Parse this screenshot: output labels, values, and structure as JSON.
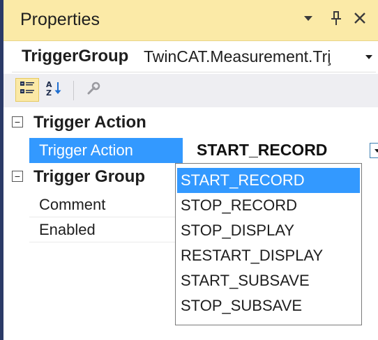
{
  "window": {
    "title": "Properties"
  },
  "object_selector": {
    "name": "TriggerGroup",
    "type": "TwinCAT.Measurement.Tri̧"
  },
  "toolbar": {
    "categorized_icon": "categorized-icon",
    "alphabetical_icon": "alphabetical-sort-icon",
    "property_pages_icon": "property-pages-icon"
  },
  "grid": {
    "categories": [
      {
        "label": "Trigger Action",
        "properties": [
          {
            "name": "Trigger Action",
            "value": "START_RECORD"
          }
        ]
      },
      {
        "label": "Trigger Group",
        "properties": [
          {
            "name": "Comment",
            "value": ""
          },
          {
            "name": "Enabled",
            "value": ""
          }
        ]
      }
    ]
  },
  "dropdown": {
    "options": [
      "START_RECORD",
      "STOP_RECORD",
      "STOP_DISPLAY",
      "RESTART_DISPLAY",
      "START_SUBSAVE",
      "STOP_SUBSAVE"
    ],
    "selected": "START_RECORD"
  },
  "colors": {
    "title_bar_bg": "#fbeaa7",
    "selection": "#3399ff",
    "toolbar_bg": "#eeeef2",
    "left_border": "#2b3a67"
  }
}
